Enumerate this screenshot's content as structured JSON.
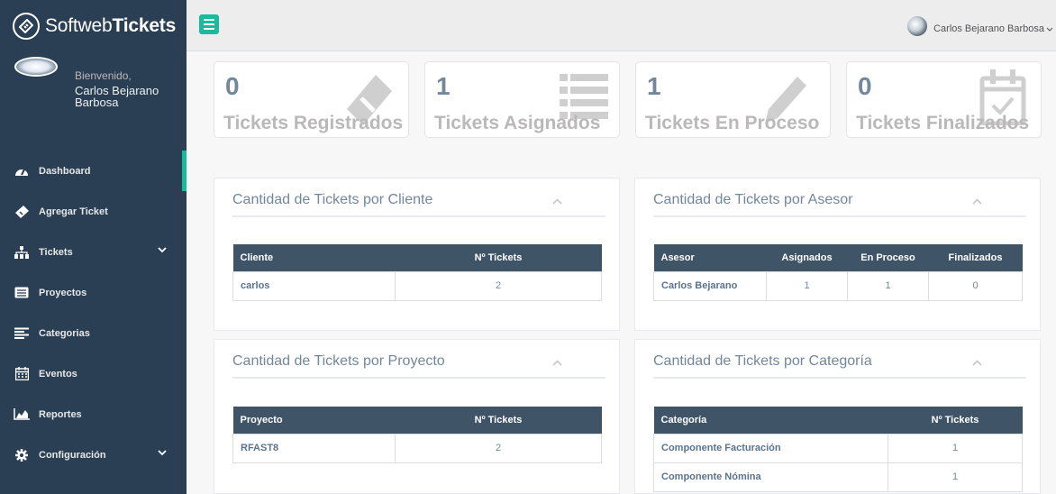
{
  "brand": {
    "prefix": "Softweb",
    "suffix": "Tickets"
  },
  "profile": {
    "welcome": "Bienvenido,",
    "name": "Carlos Bejarano Barbosa"
  },
  "menu": [
    {
      "label": "Dashboard",
      "icon": "dashboard-icon"
    },
    {
      "label": "Agregar Ticket",
      "icon": "ticket-icon"
    },
    {
      "label": "Tickets",
      "icon": "sitemap-icon"
    },
    {
      "label": "Proyectos",
      "icon": "list-alt-icon"
    },
    {
      "label": "Categorias",
      "icon": "align-left-icon"
    },
    {
      "label": "Eventos",
      "icon": "calendar-icon"
    },
    {
      "label": "Reportes",
      "icon": "area-chart-icon"
    },
    {
      "label": "Configuración",
      "icon": "gear-icon"
    }
  ],
  "topnav": {
    "user": "Carlos Bejarano Barbosa"
  },
  "tiles": [
    {
      "count": "0",
      "label": "Tickets Registrados",
      "icon": "ticket-icon"
    },
    {
      "count": "1",
      "label": "Tickets Asignados",
      "icon": "list-icon"
    },
    {
      "count": "1",
      "label": "Tickets En Proceso",
      "icon": "pencil-icon"
    },
    {
      "count": "0",
      "label": "Tickets Finalizados",
      "icon": "calendar-check-icon"
    }
  ],
  "panels": {
    "cliente": {
      "title": "Cantidad de Tickets por Cliente",
      "headers": [
        "Cliente",
        "Nº Tickets"
      ],
      "rows": [
        [
          "carlos",
          "2"
        ]
      ]
    },
    "asesor": {
      "title": "Cantidad de Tickets por Asesor",
      "headers": [
        "Asesor",
        "Asignados",
        "En Proceso",
        "Finalizados"
      ],
      "rows": [
        [
          "Carlos Bejarano",
          "1",
          "1",
          "0"
        ]
      ]
    },
    "proyecto": {
      "title": "Cantidad de Tickets por Proyecto",
      "headers": [
        "Proyecto",
        "Nº Tickets"
      ],
      "rows": [
        [
          "RFAST8",
          "2"
        ]
      ]
    },
    "categoria": {
      "title": "Cantidad de Tickets por Categoría",
      "headers": [
        "Categoría",
        "Nº Tickets"
      ],
      "rows": [
        [
          "Componente Facturación",
          "1"
        ],
        [
          "Componente Nómina",
          "1"
        ]
      ]
    }
  },
  "colors": {
    "sidebar": "#2a3f54",
    "accent": "#1abb9c",
    "table_header": "#405467"
  }
}
